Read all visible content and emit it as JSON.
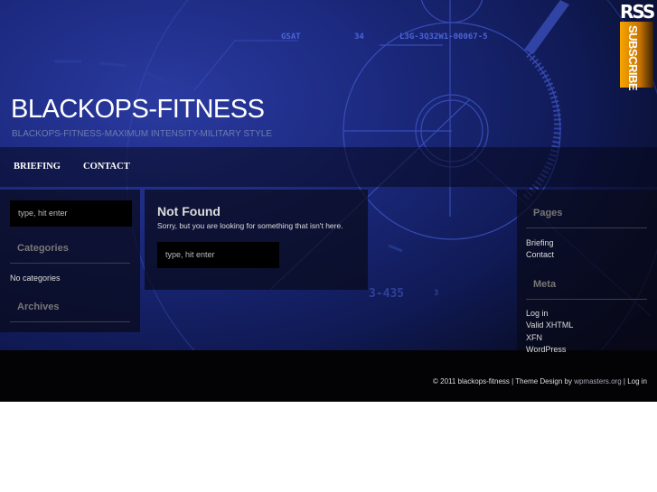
{
  "site": {
    "title": "BLACKOPS-FITNESS",
    "tagline": "BLACKOPS-FITNESS-MAXIMUM INTENSITY-MILITARY STYLE"
  },
  "hud": {
    "t1": "GSAT",
    "t2": "34",
    "t3": "L3G-3Q32W1-00067-5",
    "t4": "3-435",
    "t5": "3"
  },
  "rss": {
    "top": "RSS",
    "bottom": "SUBSCRIBE"
  },
  "nav": [
    {
      "label": "BRIEFING"
    },
    {
      "label": "CONTACT"
    }
  ],
  "left_sidebar": {
    "search_placeholder": "type, hit enter",
    "categories_title": "Categories",
    "categories_empty": "No categories",
    "archives_title": "Archives"
  },
  "main": {
    "heading": "Not Found",
    "message": "Sorry, but you are looking for something that isn't here.",
    "search_placeholder": "type, hit enter"
  },
  "right_sidebar": {
    "pages_title": "Pages",
    "pages": [
      "Briefing",
      "Contact"
    ],
    "meta_title": "Meta",
    "meta": [
      "Log in",
      "Valid XHTML",
      "XFN",
      "WordPress"
    ]
  },
  "footer": {
    "copyright": "© 2011 blackops-fitness | Theme Design by ",
    "designer": "wpmasters.org",
    "sep": " | ",
    "login": "Log in"
  }
}
